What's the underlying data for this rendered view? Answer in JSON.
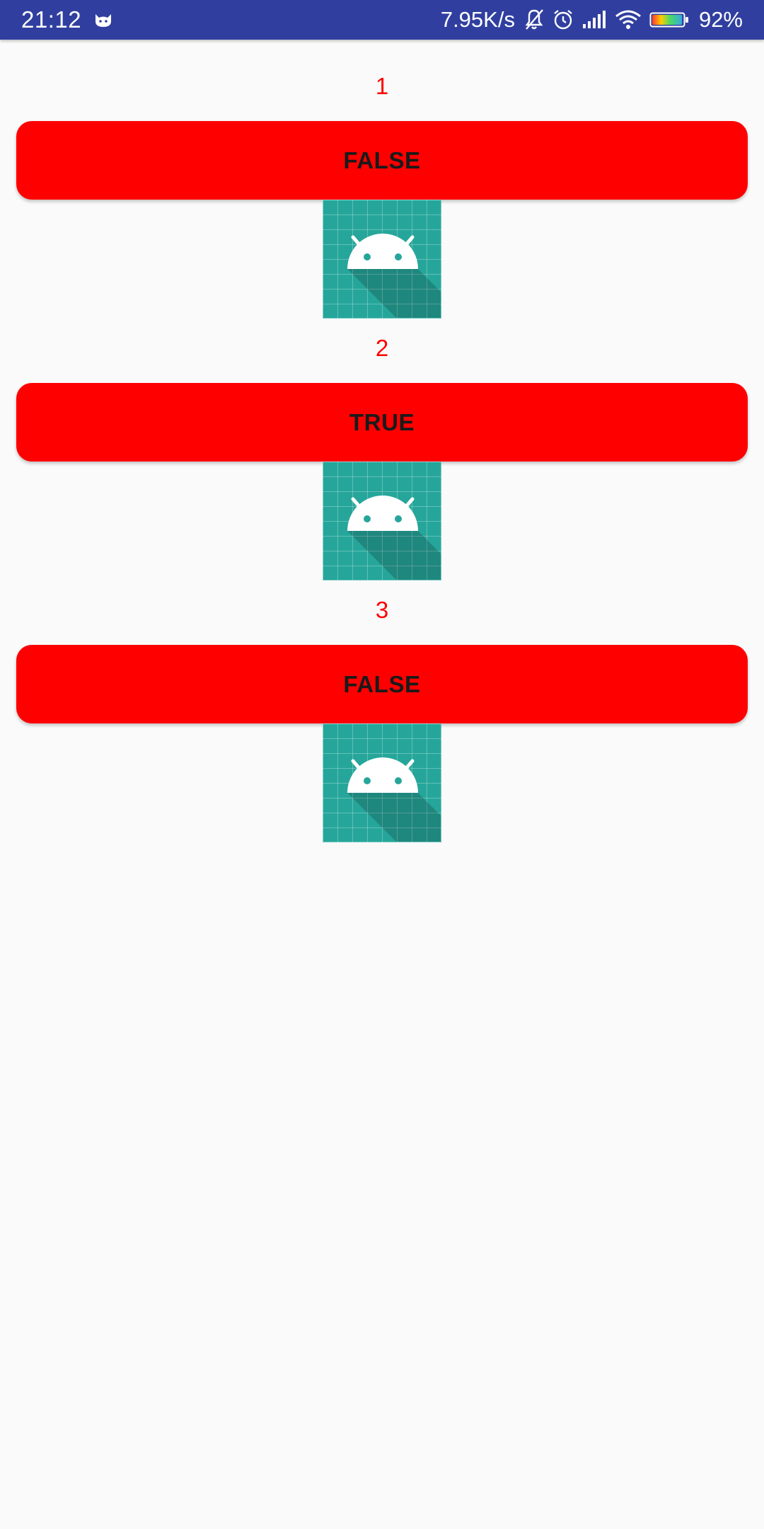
{
  "status_bar": {
    "time": "21:12",
    "network_speed": "7.95K/s",
    "battery_percent": "92%",
    "icons": [
      "cat-notification-icon",
      "bell-muted-icon",
      "alarm-icon",
      "signal-icon",
      "wifi-icon",
      "battery-icon"
    ],
    "background_color": "#303f9f"
  },
  "items": [
    {
      "label": "1",
      "button_text": "FALSE",
      "image": "android-launcher-icon"
    },
    {
      "label": "2",
      "button_text": "TRUE",
      "image": "android-launcher-icon"
    },
    {
      "label": "3",
      "button_text": "FALSE",
      "image": "android-launcher-icon"
    }
  ],
  "colors": {
    "accent": "#ff0000",
    "image_background": "#26a69a",
    "page_background": "#fafafa"
  }
}
